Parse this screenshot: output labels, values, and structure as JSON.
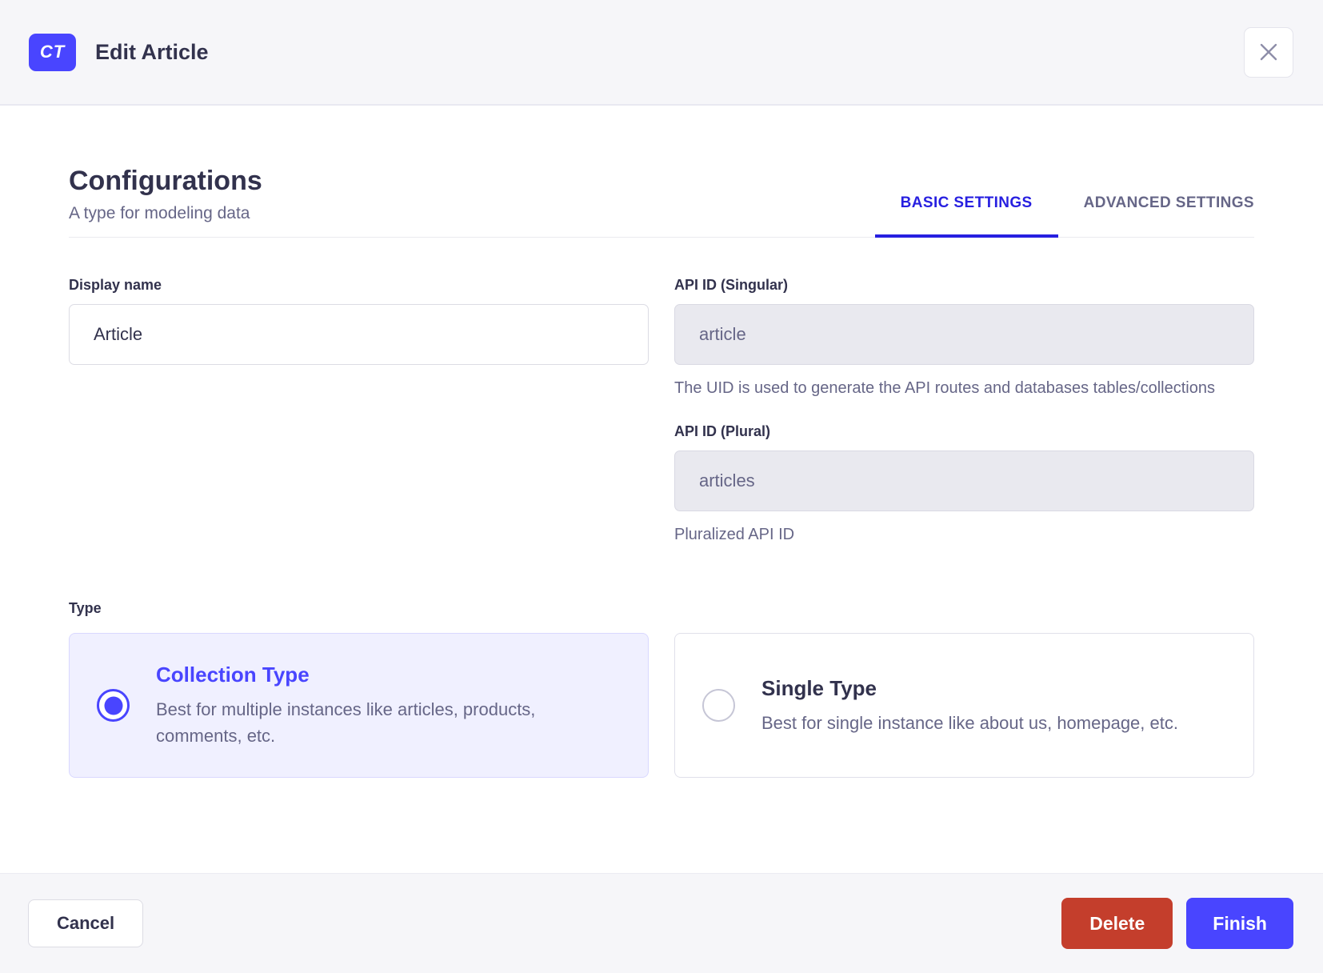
{
  "header": {
    "badge_label": "CT",
    "title": "Edit Article"
  },
  "config": {
    "title": "Configurations",
    "subtitle": "A type for modeling data",
    "tabs": [
      {
        "label": "BASIC SETTINGS",
        "active": true
      },
      {
        "label": "ADVANCED SETTINGS",
        "active": false
      }
    ]
  },
  "form": {
    "display_name": {
      "label": "Display name",
      "value": "Article"
    },
    "api_id_singular": {
      "label": "API ID (Singular)",
      "value": "article",
      "hint": "The UID is used to generate the API routes and databases tables/collections"
    },
    "api_id_plural": {
      "label": "API ID (Plural)",
      "value": "articles",
      "hint": "Pluralized API ID"
    },
    "type": {
      "label": "Type",
      "options": [
        {
          "title": "Collection Type",
          "description": "Best for multiple instances like articles, products, comments, etc.",
          "selected": true
        },
        {
          "title": "Single Type",
          "description": "Best for single instance like about us, homepage, etc.",
          "selected": false
        }
      ]
    }
  },
  "footer": {
    "cancel_label": "Cancel",
    "delete_label": "Delete",
    "finish_label": "Finish"
  },
  "colors": {
    "primary": "#4945ff",
    "tab_active": "#271fe0",
    "danger": "#c43e2c",
    "header_bg": "#f6f6f9",
    "selected_card_bg": "#f0f0ff",
    "selected_card_border": "#d9d8ff",
    "text_dark": "#32324d",
    "text_muted": "#666687",
    "disabled_bg": "#e9e9ef"
  }
}
